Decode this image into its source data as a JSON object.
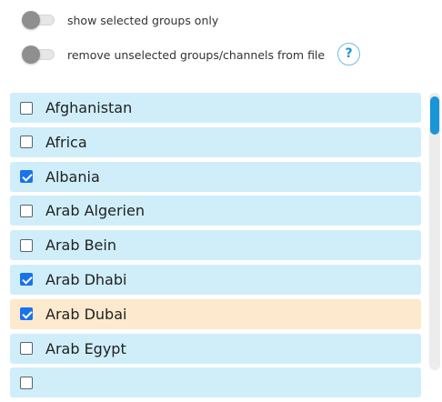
{
  "toggles": [
    {
      "label": "show selected groups only",
      "on": false
    },
    {
      "label": "remove unselected groups/channels from file",
      "on": false
    }
  ],
  "help": {
    "label": "?"
  },
  "groups": [
    {
      "label": "Afghanistan",
      "checked": false,
      "selected": false
    },
    {
      "label": "Africa",
      "checked": false,
      "selected": false
    },
    {
      "label": "Albania",
      "checked": true,
      "selected": false
    },
    {
      "label": "Arab Algerien",
      "checked": false,
      "selected": false
    },
    {
      "label": "Arab Bein",
      "checked": false,
      "selected": false
    },
    {
      "label": "Arab Dhabi",
      "checked": true,
      "selected": false
    },
    {
      "label": "Arab Dubai",
      "checked": true,
      "selected": true
    },
    {
      "label": "Arab Egypt",
      "checked": false,
      "selected": false
    }
  ],
  "colors": {
    "item_bg": "#cfeef9",
    "item_selected_bg": "#fde9cd",
    "accent": "#1a95d7",
    "checkbox_checked": "#1a73e8"
  }
}
